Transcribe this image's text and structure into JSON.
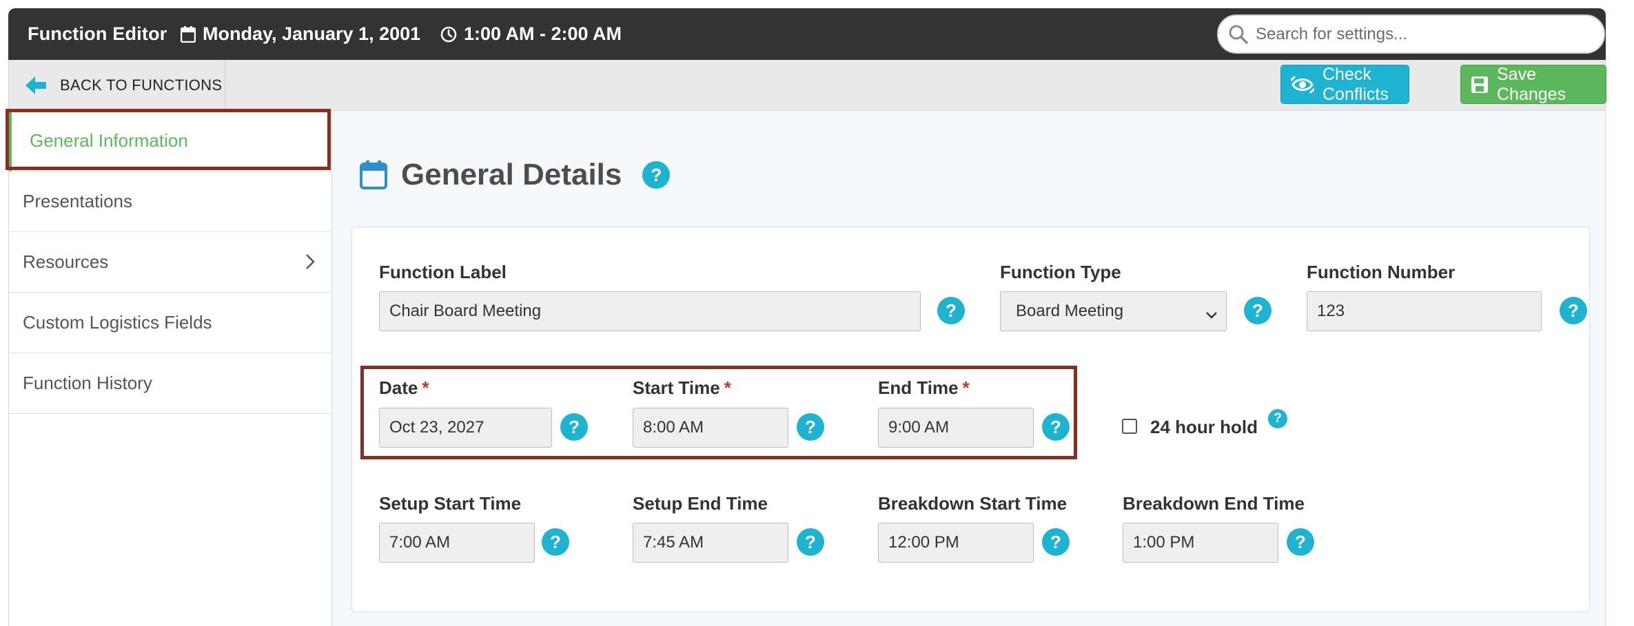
{
  "header": {
    "title": "Function Editor",
    "date": "Monday, January 1, 2001",
    "time_range": "1:00 AM - 2:00 AM",
    "search_placeholder": "Search for settings..."
  },
  "toolbar": {
    "back_label": "BACK TO FUNCTIONS",
    "check_conflicts_label": "Check Conflicts",
    "save_label": "Save Changes"
  },
  "sidebar": {
    "items": [
      {
        "label": "General Information",
        "active": true
      },
      {
        "label": "Presentations"
      },
      {
        "label": "Resources",
        "has_children": true
      },
      {
        "label": "Custom Logistics Fields"
      },
      {
        "label": "Function History"
      }
    ]
  },
  "main": {
    "section_title": "General Details",
    "fields": {
      "function_label": {
        "label": "Function Label",
        "value": "Chair Board Meeting"
      },
      "function_type": {
        "label": "Function Type",
        "value": "Board Meeting"
      },
      "function_number": {
        "label": "Function Number",
        "value": "123"
      },
      "date": {
        "label": "Date",
        "value": "Oct 23, 2027",
        "required": true
      },
      "start_time": {
        "label": "Start Time",
        "value": "8:00 AM",
        "required": true
      },
      "end_time": {
        "label": "End Time",
        "value": "9:00 AM",
        "required": true
      },
      "hold_24": {
        "label": "24 hour hold",
        "checked": false
      },
      "setup_start": {
        "label": "Setup Start Time",
        "value": "7:00 AM"
      },
      "setup_end": {
        "label": "Setup End Time",
        "value": "7:45 AM"
      },
      "breakdown_start": {
        "label": "Breakdown Start Time",
        "value": "12:00 PM"
      },
      "breakdown_end": {
        "label": "Breakdown End Time",
        "value": "1:00 PM"
      }
    },
    "required_marker": "*",
    "help_glyph": "?"
  },
  "colors": {
    "topbar": "#333333",
    "accent_cyan": "#1fb3d2",
    "accent_green": "#5cb85c",
    "highlight": "#8a2e22",
    "required": "#c0392b"
  }
}
